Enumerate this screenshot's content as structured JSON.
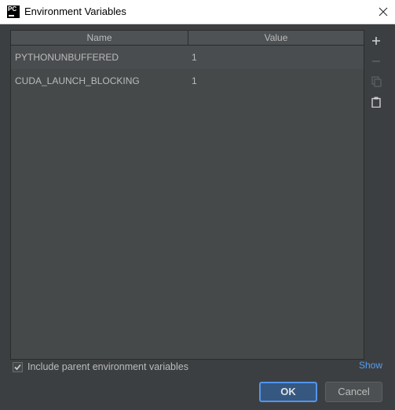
{
  "window": {
    "title": "Environment Variables",
    "app_icon_text": "PC"
  },
  "table": {
    "columns": [
      "Name",
      "Value"
    ],
    "rows": [
      {
        "name": "PYTHONUNBUFFERED",
        "value": "1"
      },
      {
        "name": "CUDA_LAUNCH_BLOCKING",
        "value": "1"
      }
    ]
  },
  "toolbar": [
    "add-icon",
    "remove-icon",
    "copy-icon",
    "paste-icon"
  ],
  "options": {
    "include_parent_label": "Include parent environment variables",
    "include_parent_checked": true,
    "show_link": "Show"
  },
  "buttons": {
    "ok": "OK",
    "cancel": "Cancel"
  },
  "colors": {
    "accent": "#5394ec",
    "link": "#589df6",
    "background": "#3c3f41"
  }
}
